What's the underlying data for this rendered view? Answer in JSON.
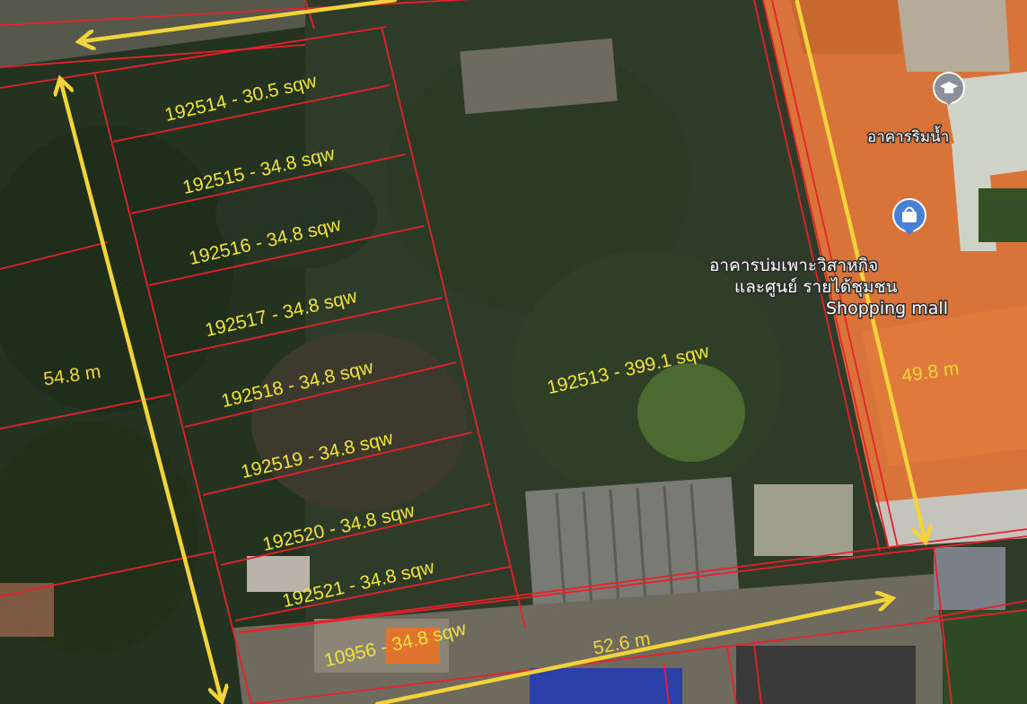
{
  "plots": [
    {
      "label": "192514 - 30.5 sqw"
    },
    {
      "label": "192515 - 34.8 sqw"
    },
    {
      "label": "192516 - 34.8 sqw"
    },
    {
      "label": "192517 - 34.8 sqw"
    },
    {
      "label": "192518 - 34.8 sqw"
    },
    {
      "label": "192519 - 34.8 sqw"
    },
    {
      "label": "192520 - 34.8 sqw"
    },
    {
      "label": "192521 - 34.8 sqw"
    },
    {
      "label": "10956 - 34.8 sqw"
    },
    {
      "label": "192513 - 399.1 sqw"
    }
  ],
  "dimensions": {
    "left": "54.8 m",
    "right": "49.8 m",
    "bottom": "52.6 m"
  },
  "places": {
    "riverside_building": "อาคารริมน้ำ",
    "mall_line1": "อาคารบ่มเพาะวิสาหกิจ",
    "mall_line2": "และศูนย์ รายได้ชุมชน",
    "mall_line3": "Shopping mall"
  },
  "icons": {
    "school": "graduation-cap-icon",
    "shopping": "shopping-bag-icon"
  },
  "colors": {
    "boundary": "#e8202a",
    "dimension_arrow": "#f2d43a",
    "plot_label": "#f2e33a",
    "roof": "#d8743a",
    "pin_blue": "#4a7fd6"
  }
}
